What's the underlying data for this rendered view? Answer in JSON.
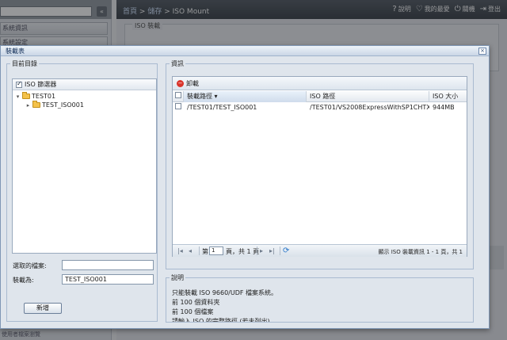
{
  "app": {
    "sidebar": {
      "search_button": "«",
      "items": [
        "系統資訊",
        "系統設定"
      ],
      "bottom_text": "使用者檔案瀏覽"
    },
    "header": {
      "crumb_home": "首頁",
      "crumb_sep": ">",
      "crumb_storage": "儲存",
      "crumb_current": "ISO Mount",
      "links": [
        {
          "icon": "?",
          "label": "說明"
        },
        {
          "icon": "♡",
          "label": "我的最愛"
        },
        {
          "icon": "⏻",
          "label": "關機"
        },
        {
          "icon": "⇥",
          "label": "登出"
        }
      ]
    },
    "content_legend": "ISO 裝載"
  },
  "dialog": {
    "title": "裝載表",
    "close": "×",
    "dir_panel": {
      "legend": "目前目錄",
      "tree_header": "ISO 篩選器",
      "tree_header_checked": true,
      "tree": [
        {
          "label": "TEST01",
          "expander": "▾"
        },
        {
          "label": "TEST_ISO001",
          "expander": "▸"
        }
      ],
      "selected_file_label": "選取的檔案:",
      "selected_file_value": "",
      "mount_as_label": "裝載為:",
      "mount_as_value": "TEST_ISO001",
      "new_button": "新增"
    },
    "info_panel": {
      "legend": "資訊",
      "unmount_button": "卸載",
      "columns": [
        "裝載路徑 ▾",
        "ISO 路徑",
        "ISO 大小"
      ],
      "rows": [
        {
          "mount_path": "/TEST01/TEST_ISO001",
          "iso_path": "/TEST01/VS2008ExpressWithSP1CHTX...",
          "iso_size": "944MB"
        }
      ],
      "pager": {
        "page_label": "第",
        "page_value": "1",
        "page_of": "頁，共 1 頁",
        "status": "顯示 ISO 裝載資訊 1 - 1 頁，共 1"
      }
    },
    "desc_panel": {
      "legend": "說明",
      "lines": [
        "只能裝載 ISO 9660/UDF 檔案系統。",
        "前 100 個資料夾",
        "前 100 個檔案",
        "請輸入 ISO 的完整路徑 (若未列出)。"
      ]
    }
  }
}
